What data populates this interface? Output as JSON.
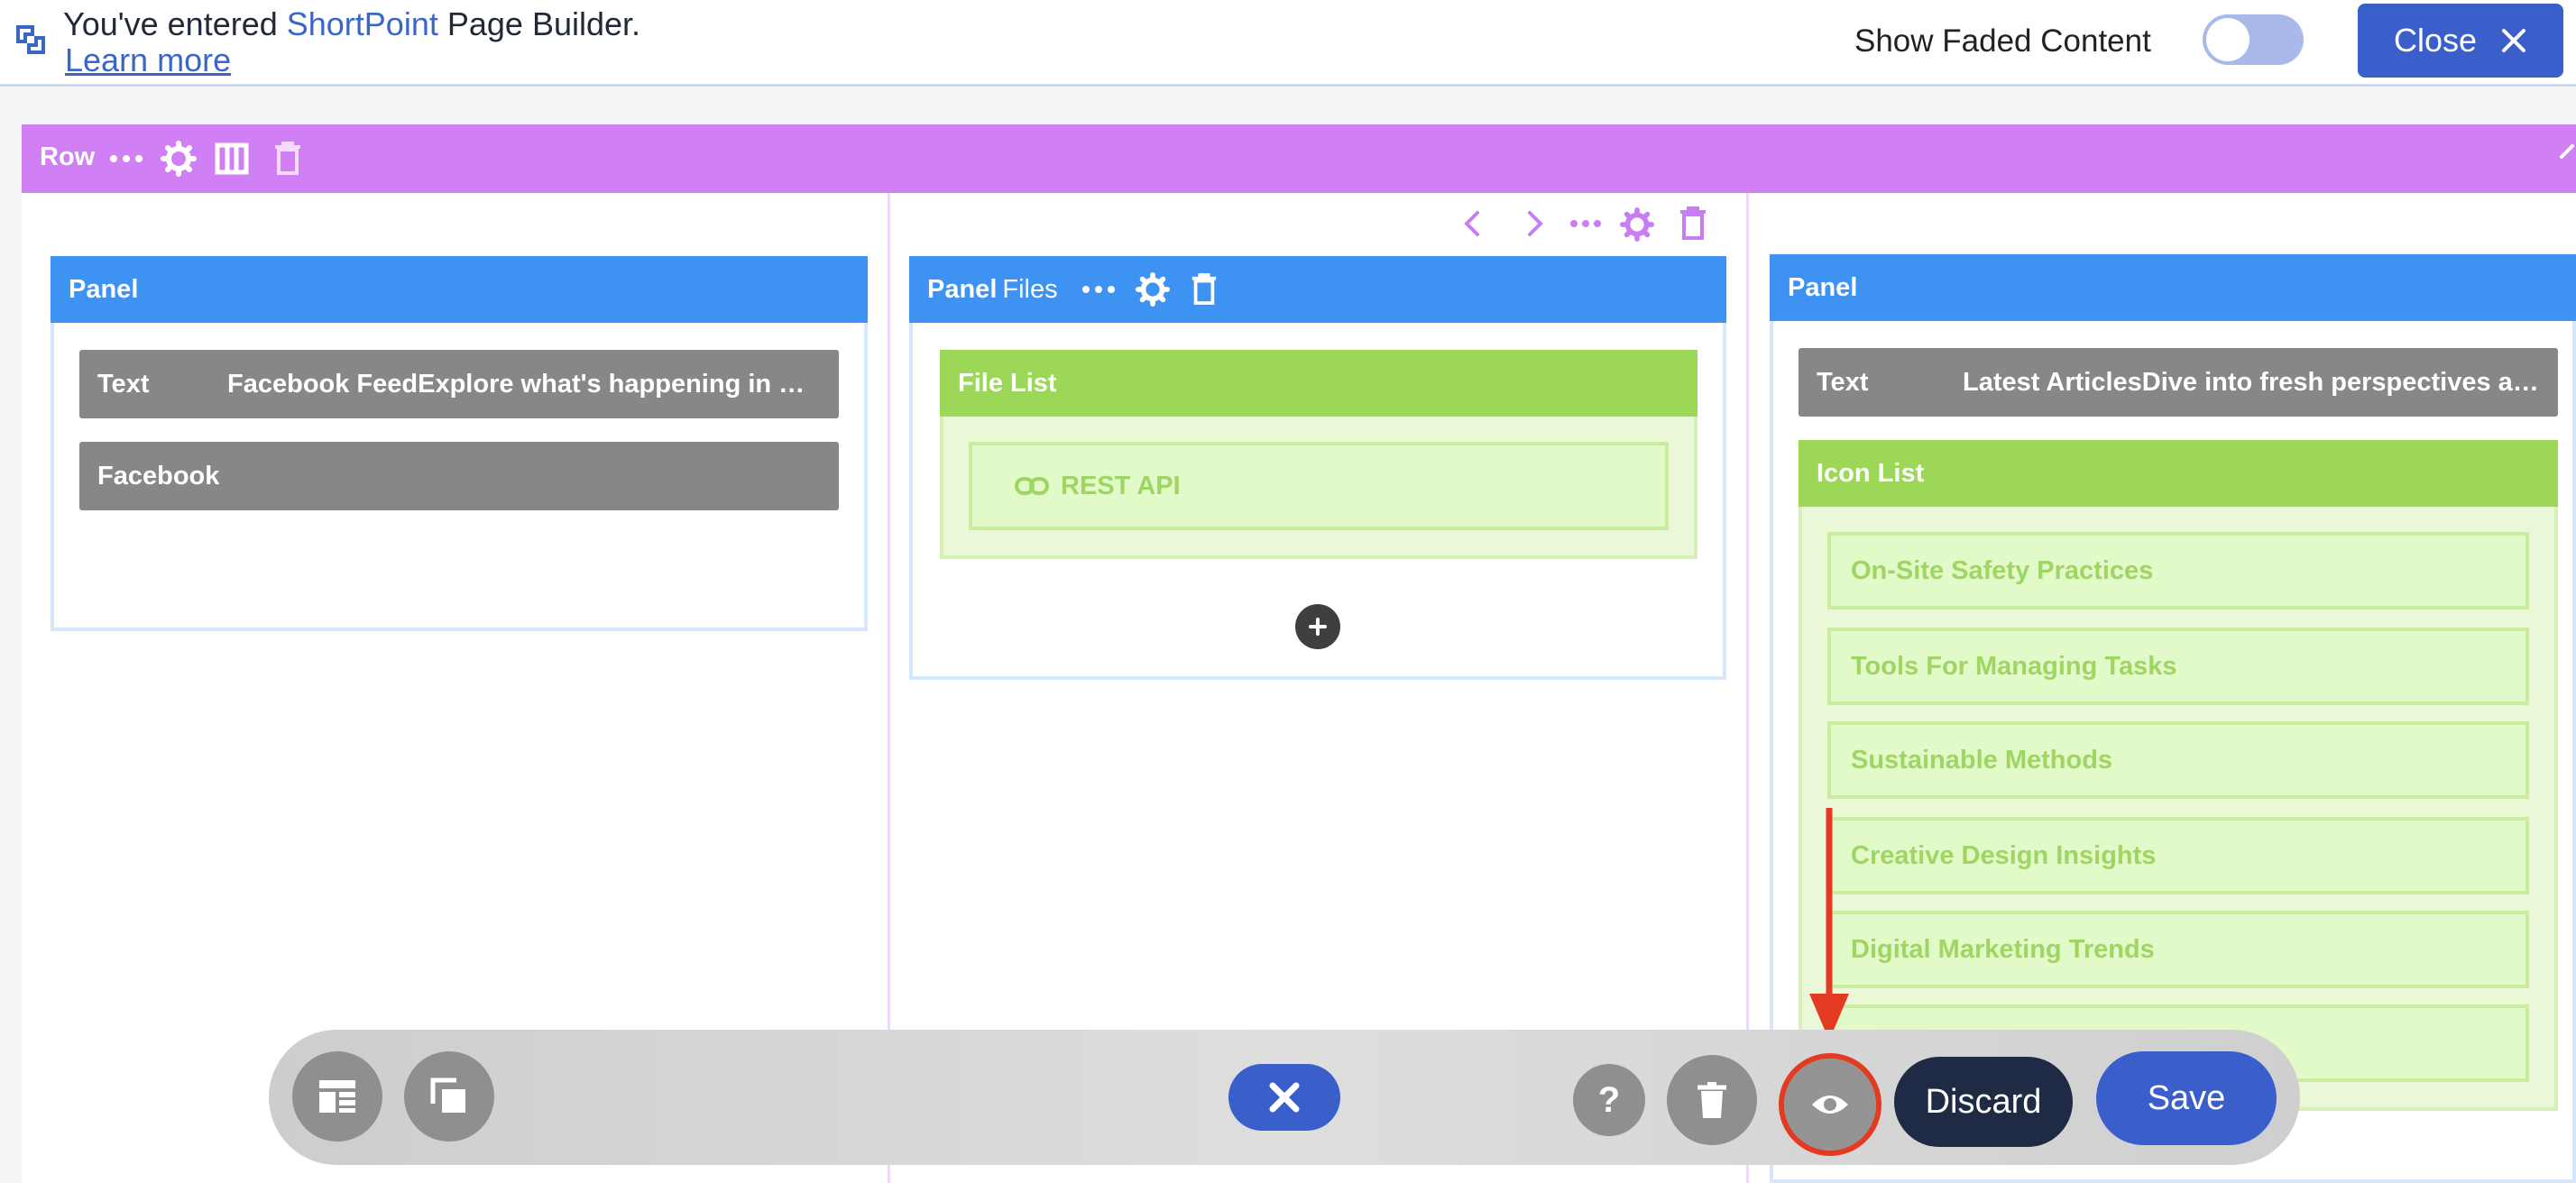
{
  "banner": {
    "prefix": "You've entered ",
    "brand": "ShortPoint",
    "suffix": " Page Builder.",
    "learn_more": "Learn more",
    "show_faded_label": "Show Faded Content",
    "show_faded_on": false,
    "close_label": "Close"
  },
  "row": {
    "label": "Row"
  },
  "columns": [
    {
      "panel_label": "Panel",
      "elements": [
        {
          "type_label": "Text",
          "content": "Facebook FeedExplore what's happening in yo..."
        },
        {
          "type_label": "Facebook",
          "content": ""
        }
      ]
    },
    {
      "panel_label": "Panel",
      "panel_subtype": "Files",
      "file_list_label": "File List",
      "file_list_item": "REST API"
    },
    {
      "panel_label": "Panel",
      "text_label": "Text",
      "text_content": "Latest ArticlesDive into fresh perspectives an...",
      "icon_list_label": "Icon List",
      "icon_list_items": [
        "On-Site Safety Practices",
        "Tools For Managing Tasks",
        "Sustainable Methods",
        "Creative Design Insights",
        "Digital Marketing Trends",
        ""
      ]
    }
  ],
  "toolbar": {
    "discard_label": "Discard",
    "save_label": "Save"
  },
  "colors": {
    "row_accent": "#d17ff4",
    "panel_blue": "#3e92f2",
    "element_gray": "#878787",
    "element_green": "#9cd757",
    "primary_button": "#3a5fcb",
    "highlight_red": "#e23b22"
  }
}
